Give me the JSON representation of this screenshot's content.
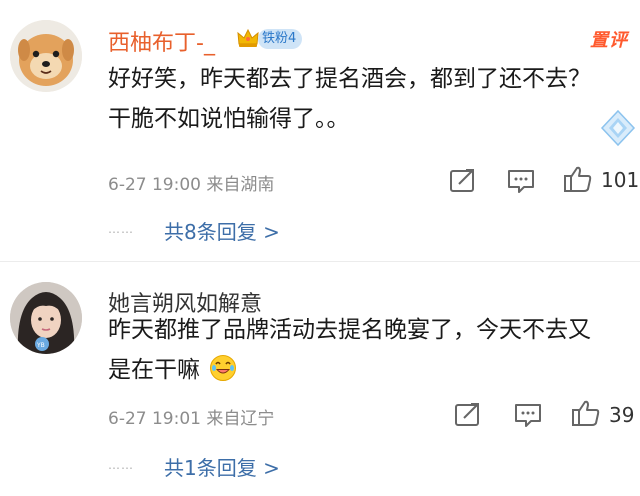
{
  "comments": [
    {
      "username": "西柚布丁-_",
      "fan_badge": "铁粉4",
      "top_tag": "置评",
      "text": "好好笑，昨天都去了提名酒会，都到了还不去？干脆不如说怕输得了。。",
      "timestamp": "6-27 19:00",
      "location": "来自湖南",
      "like_count": "101",
      "dots": "……",
      "more_replies": "共8条回复 >",
      "colors": {
        "username": "#e8602c",
        "badge_bg": "#cfe4f7",
        "badge_text": "#2b78c9"
      }
    },
    {
      "username": "她言朔风如解意",
      "text": "昨天都推了品牌活动去提名晚宴了，今天不去又是在干嘛",
      "timestamp": "6-27 19:01",
      "location": "来自辽宁",
      "like_count": "39",
      "dots": "……",
      "more_replies": "共1条回复 >"
    }
  ],
  "icons": {
    "share": "share-icon",
    "reply": "comment-icon",
    "like": "thumbs-up-icon",
    "laugh": "laughing-emoji-icon",
    "crown": "crown-icon",
    "gem": "diamond-icon"
  },
  "colors": {
    "link": "#3d6ea8",
    "meta": "#8c8c8c",
    "accent": "#ff5a2e"
  }
}
